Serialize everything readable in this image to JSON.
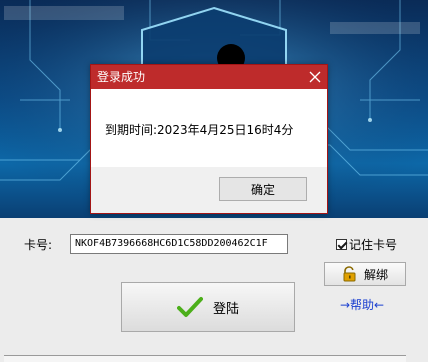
{
  "login_form": {
    "card_label": "卡号:",
    "card_value": "NKOF4B7396668HC6D1C58DD200462C1F",
    "remember_label": "记住卡号",
    "remember_checked": true,
    "unbind_label": "解绑",
    "help_label": "→帮助←",
    "login_label": "登陆"
  },
  "dialog": {
    "title": "登录成功",
    "message": "到期时间:2023年4月25日16时4分",
    "ok_label": "确定"
  },
  "colors": {
    "dialog_titlebar": "#be2b2b",
    "help_link": "#1a3fd0",
    "check_icon": "#4caf1a",
    "lock_icon": "#e0a000"
  },
  "icons": [
    "close-icon",
    "check-icon",
    "lock-open-icon",
    "shield-keyhole-icon"
  ]
}
